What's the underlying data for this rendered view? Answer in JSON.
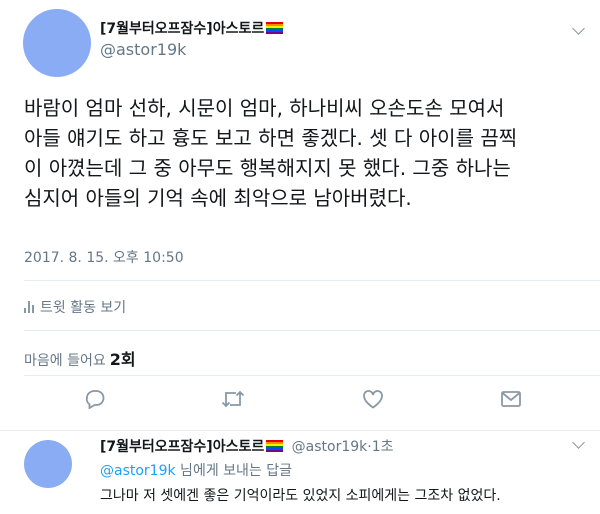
{
  "tweet": {
    "user_name": "[7월부터오프잠수]아스토르",
    "handle": "@astor19k",
    "text_lines": [
      "바람이 엄마 선하, 시문이 엄마, 하나비씨 오손도손 모여서",
      "아들 얘기도 하고 흉도 보고 하면 좋겠다. 셋 다 아이를 끔찍",
      "이 아꼈는데 그 중 아무도 행복해지지 못 했다. 그중 하나는",
      "심지어 아들의 기억 속에 최악으로 남아버렸다."
    ],
    "timestamp": "2017. 8. 15. 오후 10:50",
    "activity_label": "트윗 활동 보기",
    "likes_label": "마음에 들어요",
    "likes_count": "2회"
  },
  "icons": {
    "more": "chevron-down-icon",
    "activity": "bar-chart-icon",
    "reply": "reply-icon",
    "retweet": "retweet-icon",
    "like": "heart-icon",
    "message": "envelope-icon"
  },
  "reply_tweet": {
    "user_name": "[7월부터오프잠수]아스토르",
    "meta": "@astor19k·1초",
    "replying_mention": "@astor19k",
    "replying_suffix": " 님에게 보내는 답글",
    "text": "그나마 저 셋에겐 좋은 기억이라도 있었지 소피에게는 그조차 없었다."
  },
  "colors": {
    "link": "#1da1f2",
    "secondary_text": "#657786",
    "avatar": "#8aacf4",
    "icon": "#8899a6"
  }
}
